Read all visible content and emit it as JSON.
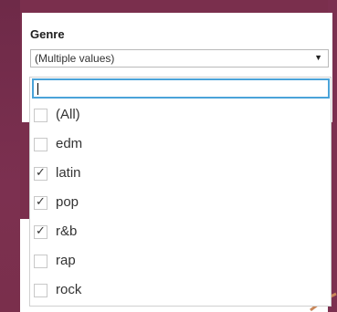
{
  "filter": {
    "title": "Genre",
    "selected_value": "(Multiple values)",
    "search_value": "",
    "items": [
      {
        "label": "(All)",
        "checked": false
      },
      {
        "label": "edm",
        "checked": false
      },
      {
        "label": "latin",
        "checked": true
      },
      {
        "label": "pop",
        "checked": true
      },
      {
        "label": "r&b",
        "checked": true
      },
      {
        "label": "rap",
        "checked": false
      },
      {
        "label": "rock",
        "checked": false
      }
    ]
  },
  "icons": {
    "dropdown_arrow": "caret-down-icon",
    "check": "checkmark-icon"
  },
  "colors": {
    "background": "#7a2f4d",
    "focus_border": "#4aa3d9"
  }
}
